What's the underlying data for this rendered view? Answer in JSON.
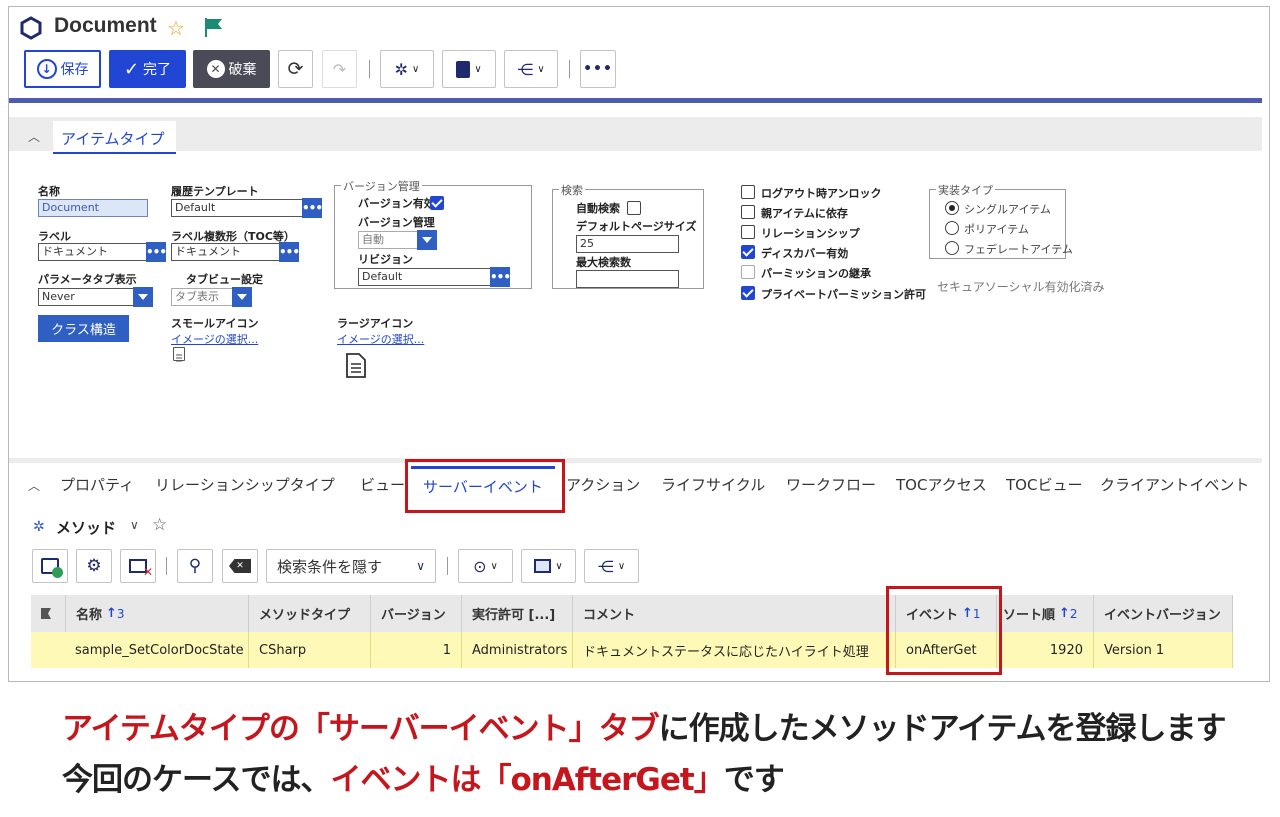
{
  "header": {
    "title": "Document"
  },
  "toolbar": {
    "save_label": "保存",
    "done_label": "完了",
    "discard_label": "破棄"
  },
  "section_tab": {
    "label": "アイテムタイプ"
  },
  "form": {
    "name_label": "名称",
    "name_value": "Document",
    "history_label": "履歴テンプレート",
    "history_value": "Default",
    "label_label": "ラベル",
    "label_value": "ドキュメント",
    "plural_label": "ラベル複数形（TOC等）",
    "plural_value": "ドキュメント",
    "param_tab_label": "パラメータタブ表示",
    "param_tab_value": "Never",
    "tab_view_label": "タブビュー設定",
    "tab_view_value": "タブ表示",
    "class_button": "クラス構造",
    "small_icon_label": "スモールアイコン",
    "small_icon_link": "イメージの選択...",
    "large_icon_label": "ラージアイコン",
    "large_icon_link": "イメージの選択..."
  },
  "version_group": {
    "legend": "バージョン管理",
    "versionable_label": "バージョン有効",
    "versionable": true,
    "manage_label": "バージョン管理",
    "manage_value": "自動",
    "revision_label": "リビジョン",
    "revision_value": "Default"
  },
  "search_group": {
    "legend": "検索",
    "auto_search_label": "自動検索",
    "auto_search": false,
    "page_size_label": "デフォルトページサイズ",
    "page_size_value": "25",
    "max_label": "最大検索数",
    "max_value": ""
  },
  "checkboxes": [
    {
      "label": "ログアウト時アンロック",
      "checked": false
    },
    {
      "label": "親アイテムに依存",
      "checked": false
    },
    {
      "label": "リレーションシップ",
      "checked": false
    },
    {
      "label": "ディスカバー有効",
      "checked": true
    },
    {
      "label": "パーミッションの継承",
      "checked": false
    },
    {
      "label": "プライベートパーミッション許可",
      "checked": true
    }
  ],
  "impl_group": {
    "legend": "実装タイプ",
    "options": [
      {
        "label": "シングルアイテム",
        "selected": true
      },
      {
        "label": "ポリアイテム",
        "selected": false
      },
      {
        "label": "フェデレートアイテム",
        "selected": false
      }
    ]
  },
  "secure_text": "セキュアソーシャル有効化済み",
  "relationship_tabs": [
    "プロパティ",
    "リレーションシップタイプ",
    "ビュー",
    "サーバーイベント",
    "アクション",
    "ライフサイクル",
    "ワークフロー",
    "TOCアクセス",
    "TOCビュー",
    "クライアントイベント"
  ],
  "active_tab_index": 3,
  "method_panel": {
    "title": "メソッド",
    "search_toggle": "検索条件を隠す"
  },
  "grid": {
    "columns": [
      {
        "label": "名称",
        "sort": "3"
      },
      {
        "label": "メソッドタイプ",
        "sort": ""
      },
      {
        "label": "バージョン",
        "sort": ""
      },
      {
        "label": "実行許可 [...]",
        "sort": ""
      },
      {
        "label": "コメント",
        "sort": ""
      },
      {
        "label": "イベント",
        "sort": "1"
      },
      {
        "label": "ソート順",
        "sort": "2"
      },
      {
        "label": "イベントバージョン",
        "sort": ""
      }
    ],
    "rows": [
      [
        "sample_SetColorDocState",
        "CSharp",
        "1",
        "Administrators",
        "ドキュメントステータスに応じたハイライト処理",
        "onAfterGet",
        "1920",
        "Version 1"
      ]
    ]
  },
  "caption": {
    "line1_red": "アイテムタイプの「サーバーイベント」タブ",
    "line1_black": "に作成したメソッドアイテムを登録します",
    "line2_black": "今回のケースでは、",
    "line2_red": "イベントは「onAfterGet」",
    "line2_end": "です"
  },
  "colors": {
    "accent": "#2146d4",
    "highlight_row": "#fff9b8",
    "callout_red": "#c4161c"
  }
}
